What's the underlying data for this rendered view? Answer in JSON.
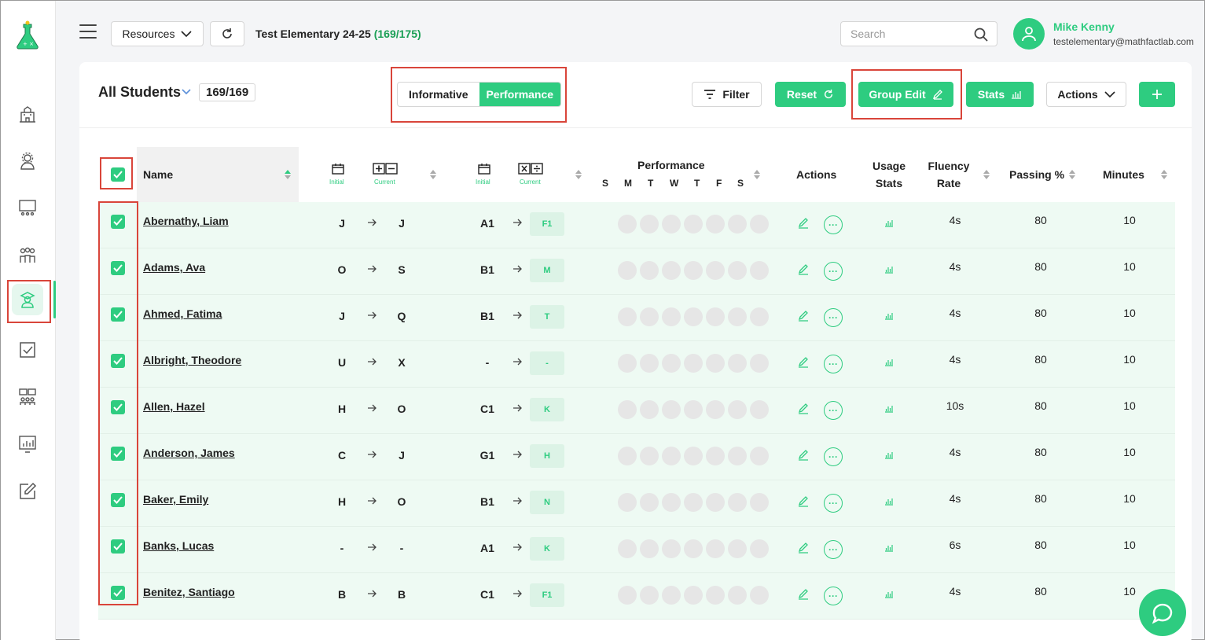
{
  "header": {
    "resources_label": "Resources",
    "school_name": "Test Elementary 24-25",
    "school_count": "(169/175)",
    "search_placeholder": "Search",
    "user_name": "Mike Kenny",
    "user_email": "testelementary@mathfactlab.com"
  },
  "sidebar": {
    "items": [
      "school-icon",
      "settings-user-icon",
      "classroom-icon",
      "groups-icon",
      "student-icon",
      "checkbox-icon",
      "assignments-icon",
      "reports-icon",
      "edit-icon"
    ],
    "active_index": 4
  },
  "toolbar": {
    "title": "All Students",
    "count": "169/169",
    "view_options": [
      "Informative",
      "Performance"
    ],
    "active_view": "Performance",
    "filter_label": "Filter",
    "reset_label": "Reset",
    "group_edit_label": "Group Edit",
    "stats_label": "Stats",
    "actions_label": "Actions"
  },
  "columns": {
    "name": "Name",
    "initial": "Initial",
    "current": "Current",
    "performance": "Performance",
    "days": [
      "S",
      "M",
      "T",
      "W",
      "T",
      "F",
      "S"
    ],
    "actions": "Actions",
    "usage_stats_1": "Usage",
    "usage_stats_2": "Stats",
    "fluency_1": "Fluency",
    "fluency_2": "Rate",
    "passing": "Passing %",
    "minutes": "Minutes"
  },
  "rows": [
    {
      "name": "Abernathy, Liam",
      "as_initial": "J",
      "as_current": "J",
      "md_initial": "A1",
      "md_current": "F1",
      "fluency": "4s",
      "passing": "80",
      "minutes": "10"
    },
    {
      "name": "Adams, Ava",
      "as_initial": "O",
      "as_current": "S",
      "md_initial": "B1",
      "md_current": "M",
      "fluency": "4s",
      "passing": "80",
      "minutes": "10"
    },
    {
      "name": "Ahmed, Fatima",
      "as_initial": "J",
      "as_current": "Q",
      "md_initial": "B1",
      "md_current": "T",
      "fluency": "4s",
      "passing": "80",
      "minutes": "10"
    },
    {
      "name": "Albright, Theodore",
      "as_initial": "U",
      "as_current": "X",
      "md_initial": "-",
      "md_current": "-",
      "fluency": "4s",
      "passing": "80",
      "minutes": "10"
    },
    {
      "name": "Allen, Hazel",
      "as_initial": "H",
      "as_current": "O",
      "md_initial": "C1",
      "md_current": "K",
      "fluency": "10s",
      "passing": "80",
      "minutes": "10"
    },
    {
      "name": "Anderson, James",
      "as_initial": "C",
      "as_current": "J",
      "md_initial": "G1",
      "md_current": "H",
      "fluency": "4s",
      "passing": "80",
      "minutes": "10"
    },
    {
      "name": "Baker, Emily",
      "as_initial": "H",
      "as_current": "O",
      "md_initial": "B1",
      "md_current": "N",
      "fluency": "4s",
      "passing": "80",
      "minutes": "10"
    },
    {
      "name": "Banks, Lucas",
      "as_initial": "-",
      "as_current": "-",
      "md_initial": "A1",
      "md_current": "K",
      "fluency": "6s",
      "passing": "80",
      "minutes": "10"
    },
    {
      "name": "Benitez, Santiago",
      "as_initial": "B",
      "as_current": "B",
      "md_initial": "C1",
      "md_current": "F1",
      "fluency": "4s",
      "passing": "80",
      "minutes": "10"
    }
  ],
  "colors": {
    "brand_green": "#2ecc80",
    "highlight_red": "#d9453a",
    "row_tint": "#eefaf3"
  }
}
